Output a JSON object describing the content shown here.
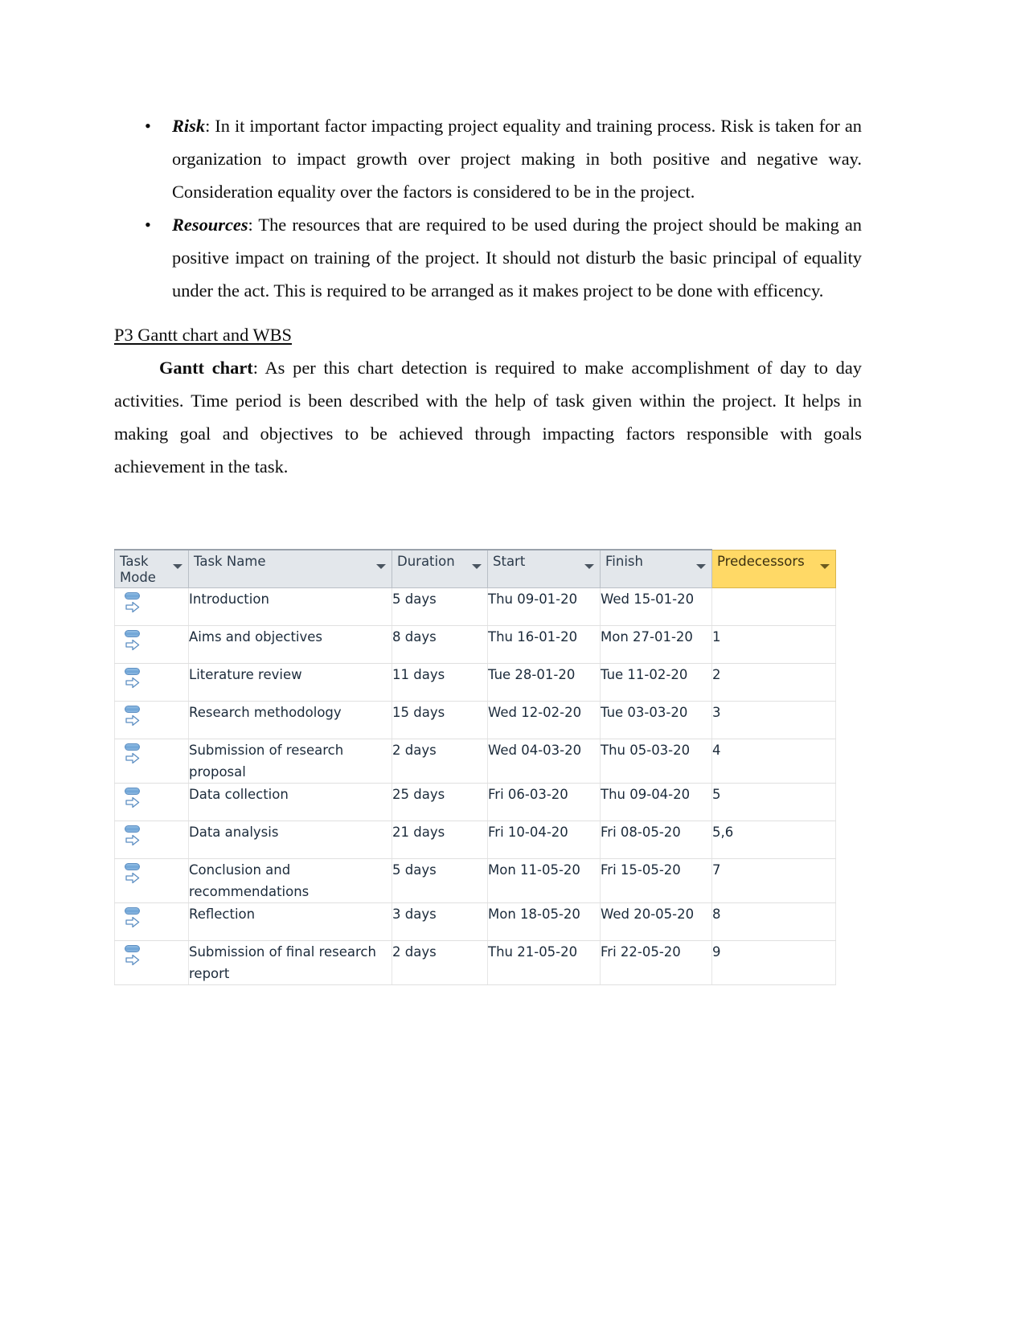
{
  "document": {
    "bullets": [
      {
        "term": "Risk",
        "text": ": In it important factor impacting project equality and training process. Risk is taken for an organization to impact growth over project making in both positive and negative way. Consideration equality over the factors is considered to be in the project."
      },
      {
        "term": "Resources",
        "text": ": The resources that are required to be used during the project should be making an positive impact on training of the project. It should not disturb the basic principal of equality under the act. This is required to be arranged as it makes project to be done with efficency."
      }
    ],
    "bullet_glyph": "•",
    "heading": "P3 Gantt chart and WBS",
    "paragraph": {
      "lead": "Gantt chart",
      "text": ": As per this chart detection is required to make accomplishment of day to day activities. Time period is been described with the help of task given within the project. It helps in making goal and objectives to be achieved through impacting factors responsible with goals achievement in the task."
    }
  },
  "colors": {
    "header_background": "#e3e7eb",
    "predecessors_header_background": "#ffd966",
    "table_text": "#1b2a3a",
    "icon_blue": "#6ea4d6",
    "grid_line": "#e0e0e0"
  },
  "project_table": {
    "columns": [
      {
        "key": "task_mode",
        "label": "Task Mode",
        "filter_icon": "filter-dropdown-icon",
        "highlighted": false
      },
      {
        "key": "task_name",
        "label": "Task Name",
        "filter_icon": "filter-dropdown-icon",
        "highlighted": false
      },
      {
        "key": "duration",
        "label": "Duration",
        "filter_icon": "filter-dropdown-icon",
        "highlighted": false
      },
      {
        "key": "start",
        "label": "Start",
        "filter_icon": "filter-dropdown-icon",
        "highlighted": false
      },
      {
        "key": "finish",
        "label": "Finish",
        "filter_icon": "filter-dropdown-icon",
        "highlighted": false
      },
      {
        "key": "predecessors",
        "label": "Predecessors",
        "filter_icon": "filter-dropdown-icon",
        "highlighted": true
      }
    ],
    "task_mode_icon": "auto-schedule-task-icon",
    "rows": [
      {
        "task_name": "Introduction",
        "duration": "5 days",
        "start": "Thu 09-01-20",
        "finish": "Wed 15-01-20",
        "predecessors": ""
      },
      {
        "task_name": "Aims and objectives",
        "duration": "8 days",
        "start": "Thu 16-01-20",
        "finish": "Mon 27-01-20",
        "predecessors": "1"
      },
      {
        "task_name": "Literature review",
        "duration": "11 days",
        "start": "Tue 28-01-20",
        "finish": "Tue 11-02-20",
        "predecessors": "2"
      },
      {
        "task_name": "Research methodology",
        "duration": "15 days",
        "start": "Wed 12-02-20",
        "finish": "Tue 03-03-20",
        "predecessors": "3"
      },
      {
        "task_name": "Submission of research proposal",
        "duration": "2 days",
        "start": "Wed 04-03-20",
        "finish": "Thu 05-03-20",
        "predecessors": "4"
      },
      {
        "task_name": "Data collection",
        "duration": "25 days",
        "start": "Fri 06-03-20",
        "finish": "Thu 09-04-20",
        "predecessors": "5"
      },
      {
        "task_name": "Data analysis",
        "duration": "21 days",
        "start": "Fri 10-04-20",
        "finish": "Fri 08-05-20",
        "predecessors": "5,6"
      },
      {
        "task_name": "Conclusion and recommendations",
        "duration": "5 days",
        "start": "Mon 11-05-20",
        "finish": "Fri 15-05-20",
        "predecessors": "7"
      },
      {
        "task_name": "Reflection",
        "duration": "3 days",
        "start": "Mon 18-05-20",
        "finish": "Wed 20-05-20",
        "predecessors": "8"
      },
      {
        "task_name": "Submission of final research report",
        "duration": "2 days",
        "start": "Thu 21-05-20",
        "finish": "Fri 22-05-20",
        "predecessors": "9"
      }
    ]
  }
}
